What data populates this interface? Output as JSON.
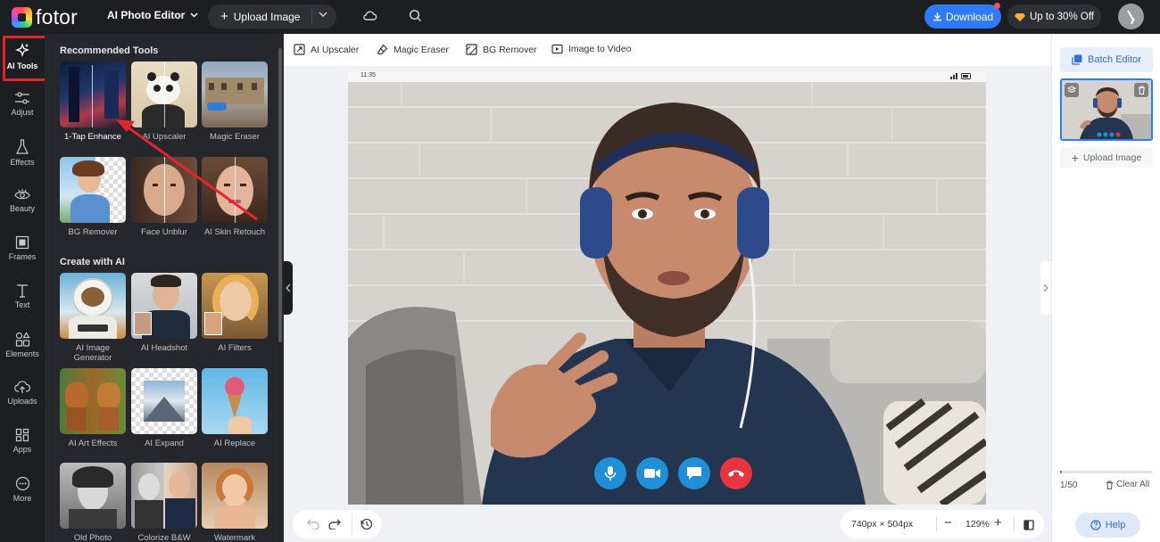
{
  "header": {
    "logo_text": "fotor",
    "editor_label": "AI Photo Editor",
    "upload_label": "Upload Image",
    "download_label": "Download",
    "offer_label": "Up to 30% Off"
  },
  "rail": {
    "items": [
      {
        "label": "AI Tools",
        "icon": "sparkle-icon",
        "active": true
      },
      {
        "label": "Adjust",
        "icon": "sliders-icon"
      },
      {
        "label": "Effects",
        "icon": "flask-icon"
      },
      {
        "label": "Beauty",
        "icon": "eye-icon"
      },
      {
        "label": "Frames",
        "icon": "frame-icon"
      },
      {
        "label": "Text",
        "icon": "text-icon"
      },
      {
        "label": "Elements",
        "icon": "shapes-icon"
      },
      {
        "label": "Uploads",
        "icon": "cloud-upload-icon"
      },
      {
        "label": "Apps",
        "icon": "grid-icon"
      },
      {
        "label": "More",
        "icon": "more-icon"
      }
    ]
  },
  "panel": {
    "recommended_title": "Recommended Tools",
    "recommended": [
      {
        "label": "1-Tap Enhance"
      },
      {
        "label": "AI Upscaler"
      },
      {
        "label": "Magic Eraser"
      },
      {
        "label": "BG Remover"
      },
      {
        "label": "Face Unblur"
      },
      {
        "label": "AI Skin Retouch"
      }
    ],
    "create_title": "Create with AI",
    "create": [
      {
        "label": "AI Image Generator"
      },
      {
        "label": "AI Headshot"
      },
      {
        "label": "AI Filters"
      },
      {
        "label": "AI Art Effects"
      },
      {
        "label": "AI Expand"
      },
      {
        "label": "AI Replace"
      },
      {
        "label": "Old Photo"
      },
      {
        "label": "Colorize B&W"
      },
      {
        "label": "Watermark"
      }
    ]
  },
  "subtoolbar": {
    "items": [
      {
        "label": "AI Upscaler",
        "icon": "upscaler-icon"
      },
      {
        "label": "Magic Eraser",
        "icon": "eraser-icon"
      },
      {
        "label": "BG Remover",
        "icon": "bg-remover-icon"
      },
      {
        "label": "Image to Video",
        "icon": "video-icon"
      }
    ]
  },
  "canvas": {
    "status_time": "11:35"
  },
  "bottombar": {
    "dimensions": "740px × 504px",
    "zoom": "129%"
  },
  "rightpanel": {
    "batch_label": "Batch Editor",
    "upload_label": "Upload Image",
    "count": "1/50",
    "progress": 0.02,
    "clear_label": "Clear All",
    "help_label": "Help"
  },
  "colors": {
    "accent": "#2f7bf5",
    "dark_bg": "#1d1e22",
    "panel_bg": "#26272c",
    "highlight": "#e3242b"
  }
}
